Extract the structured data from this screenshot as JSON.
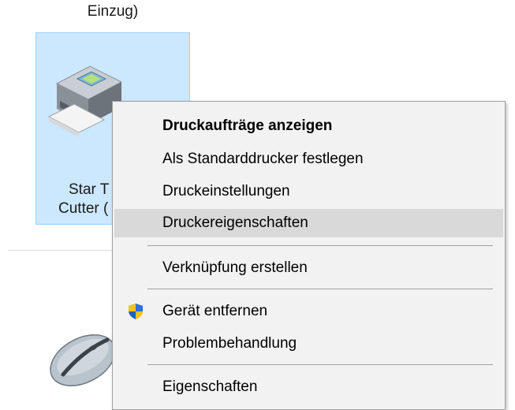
{
  "desktop": {
    "top_label": "Einzug)",
    "printer_label_line1": "Star T",
    "printer_label_line2": "Cutter ("
  },
  "context_menu": {
    "items": [
      {
        "label": "Druckaufträge anzeigen",
        "bold": true
      },
      {
        "label": "Als Standarddrucker festlegen"
      },
      {
        "label": "Druckeinstellungen"
      },
      {
        "label": "Druckereigenschaften",
        "highlighted": true
      },
      {
        "label": "Verknüpfung erstellen"
      },
      {
        "label": "Gerät entfernen",
        "icon": "uac-shield-icon"
      },
      {
        "label": "Problembehandlung"
      },
      {
        "label": "Eigenschaften"
      }
    ]
  },
  "colors": {
    "selection_tile": "#cce8ff",
    "menu_background": "#f2f2f2",
    "menu_highlight": "#d9d9d9"
  }
}
